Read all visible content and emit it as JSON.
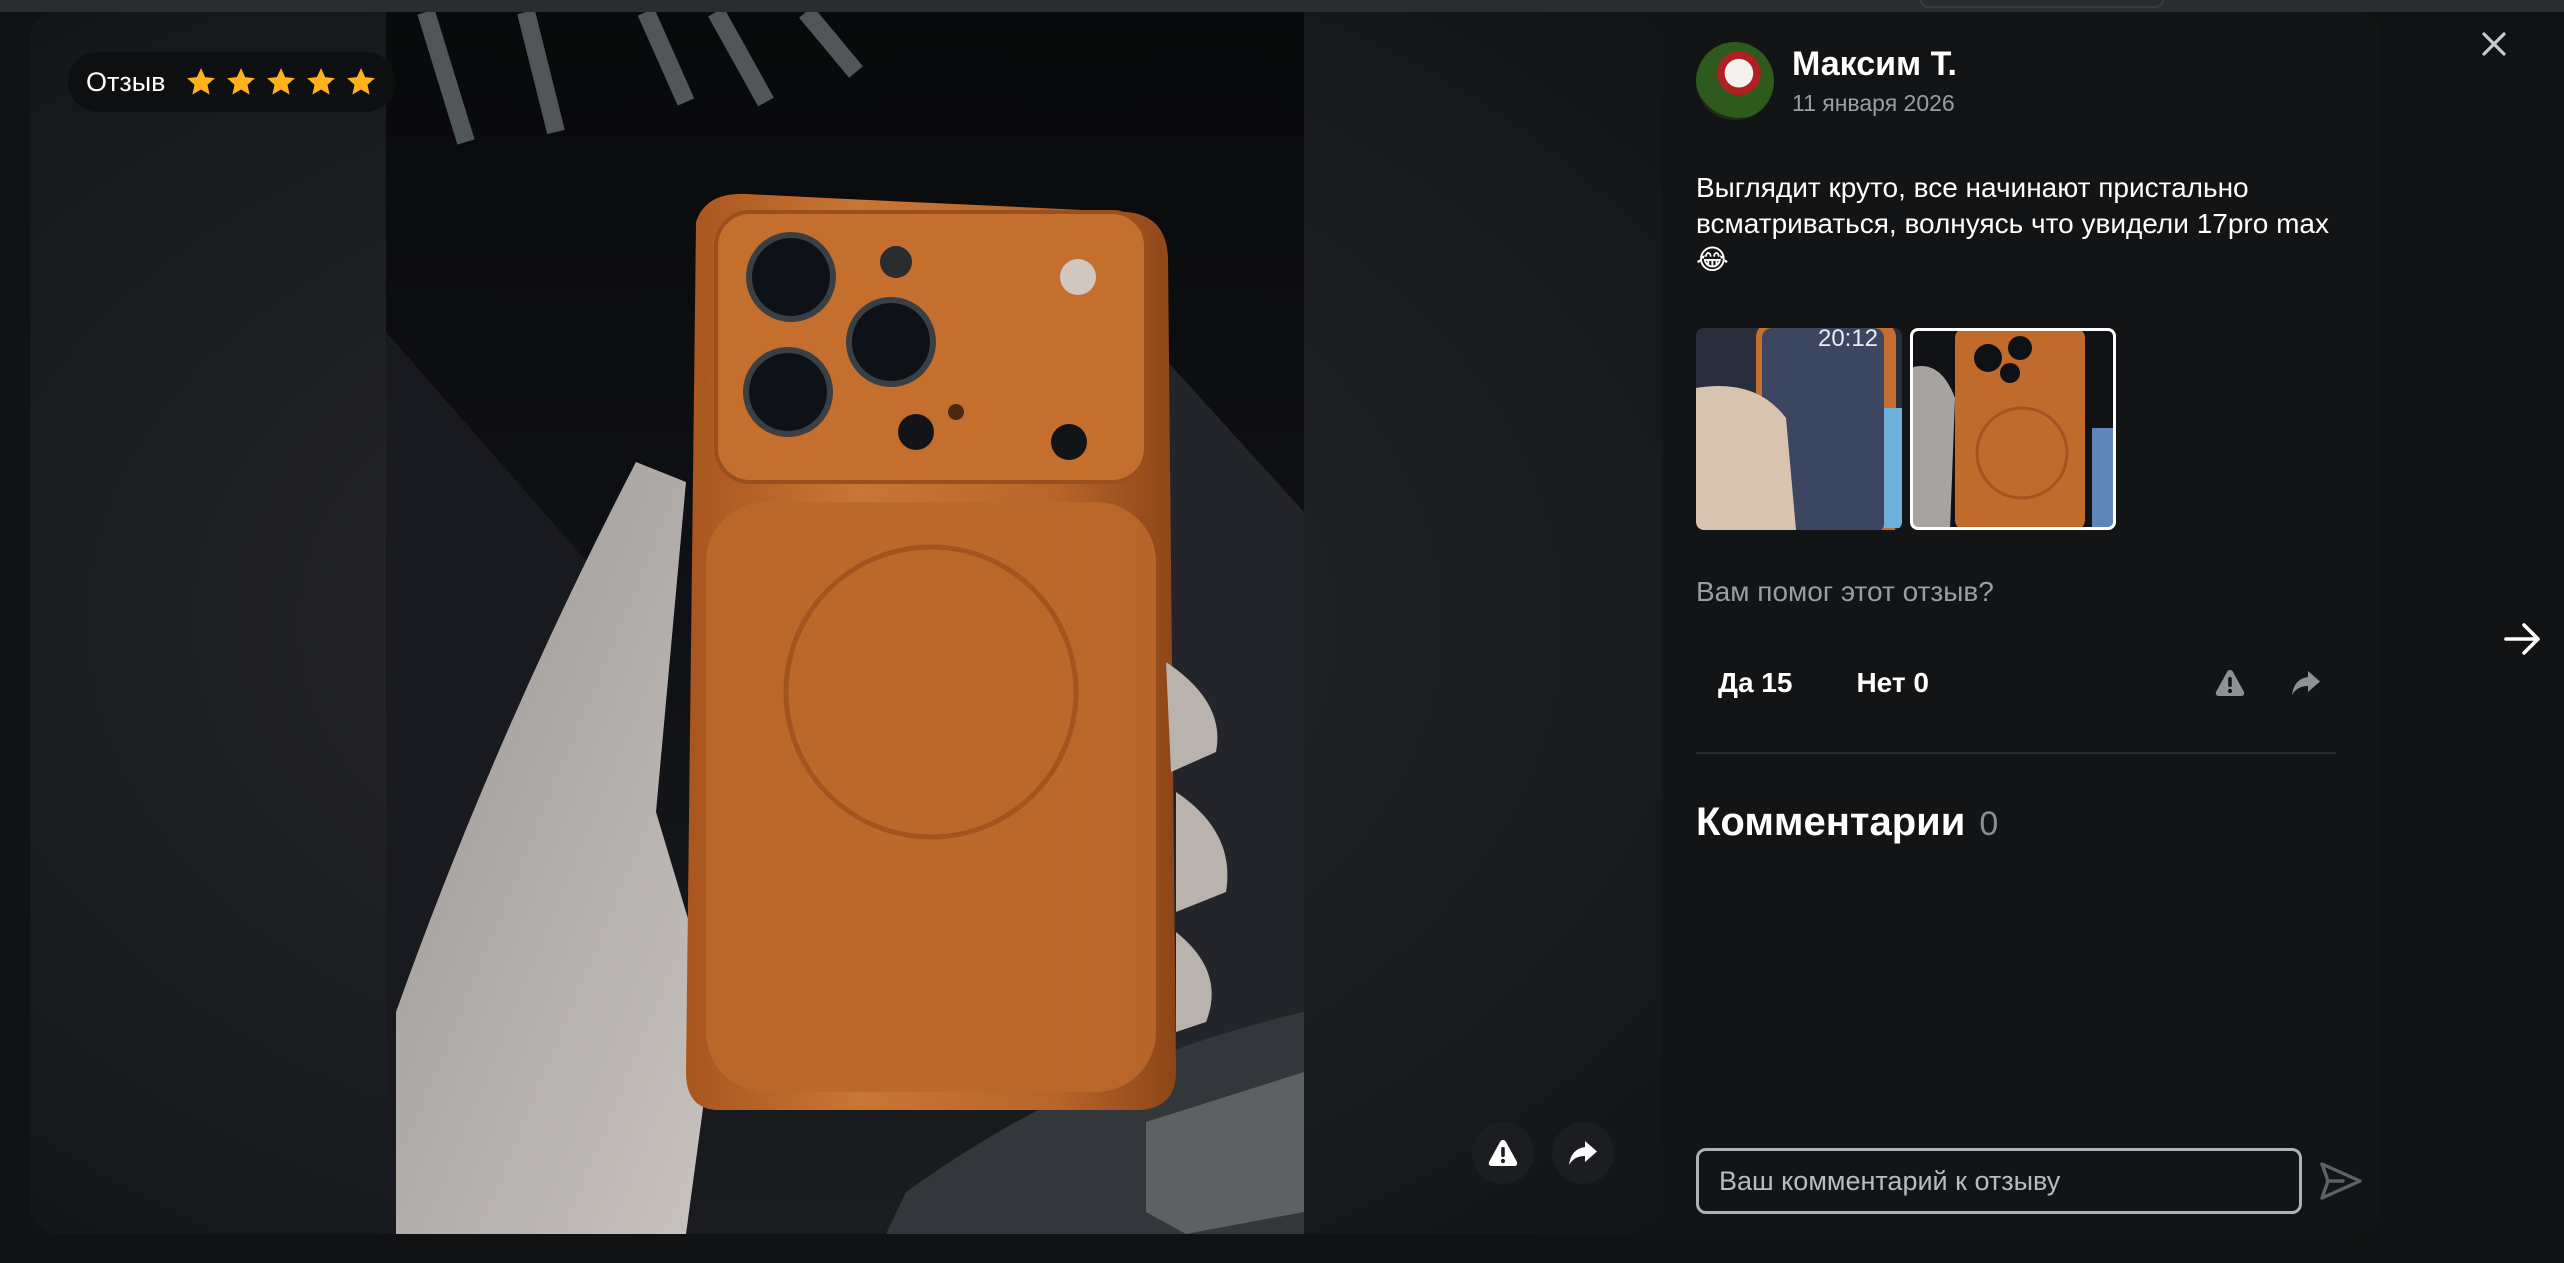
{
  "viewer": {
    "rating_label": "Отзыв",
    "rating": 5,
    "rating_max": 5,
    "star_color": "#ffb21e"
  },
  "review": {
    "author_name": "Максим Т.",
    "date": "11 января 2026",
    "text": "Выглядит круто, все начинают пристально всматриваться, волнуясь что увидели 17pro max😂",
    "thumb_clock": "20:12"
  },
  "helpful": {
    "question": "Вам помог этот отзыв?",
    "yes_label": "Да 15",
    "no_label": "Нет 0"
  },
  "comments": {
    "title": "Комментарии",
    "count": "0",
    "placeholder": "Ваш комментарий к отзыву"
  },
  "icons": {
    "close": "close-icon",
    "next": "arrow-right-icon",
    "report": "warning-icon",
    "share": "share-icon",
    "send": "send-icon",
    "star": "star-icon"
  },
  "colors": {
    "panel_bg": "#121415",
    "secondary_text": "#9a9ea3",
    "case_color": "#c06a2c"
  }
}
